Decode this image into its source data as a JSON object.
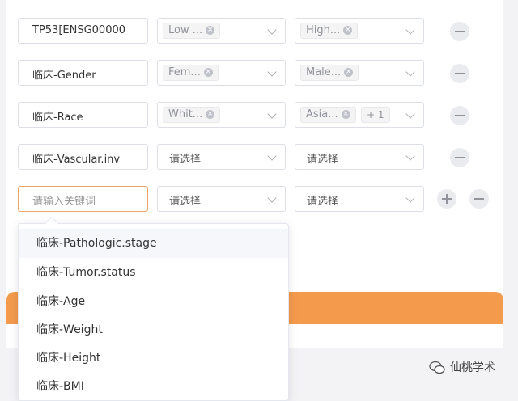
{
  "rows": [
    {
      "input": "TP53[ENSG00000",
      "select1_tags": [
        "Low ..."
      ],
      "select2_tags": [
        "High..."
      ],
      "select2_extra": ""
    },
    {
      "input": "临床-Gender",
      "select1_tags": [
        "Fem..."
      ],
      "select2_tags": [
        "Male..."
      ],
      "select2_extra": ""
    },
    {
      "input": "临床-Race",
      "select1_tags": [
        "Whit..."
      ],
      "select2_tags": [
        "Asia..."
      ],
      "select2_extra": "+ 1"
    },
    {
      "input": "临床-Vascular.inv",
      "select1_placeholder": "请选择",
      "select2_placeholder": "请选择"
    }
  ],
  "new_row": {
    "input_placeholder": "请输入关键词",
    "select1_placeholder": "请选择",
    "select2_placeholder": "请选择"
  },
  "dropdown_options": [
    "临床-Pathologic.stage",
    "临床-Tumor.status",
    "临床-Age",
    "临床-Weight",
    "临床-Height",
    "临床-BMI"
  ],
  "watermark": "仙桃学术",
  "icons": {
    "remove": "minus-circle-icon",
    "add": "plus-circle-icon",
    "tag_close": "close-icon",
    "dropdown": "chevron-down-icon"
  },
  "colors": {
    "accent": "#f39a4d",
    "focus_border": "#e9a466"
  }
}
